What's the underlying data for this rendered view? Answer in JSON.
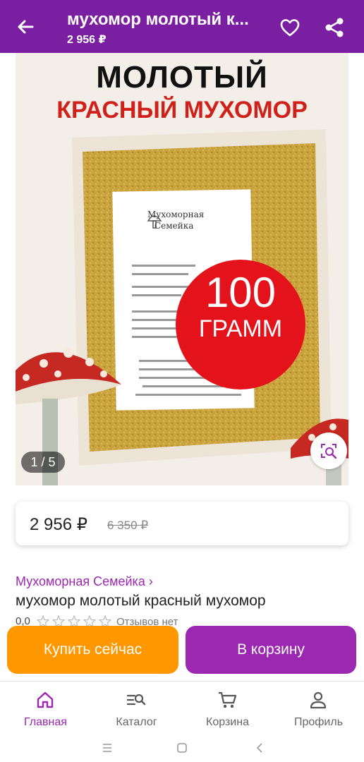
{
  "header": {
    "title": "мухомор молотый к...",
    "price": "2 956 ₽",
    "back_icon": "arrow-left-icon",
    "favorite_icon": "heart-icon",
    "share_icon": "share-icon",
    "bg_color": "#7b1fa2"
  },
  "gallery": {
    "image_text_line1": "МОЛОТЫЙ",
    "image_text_line2": "КРАСНЫЙ МУХОМОР",
    "badge_number": "100",
    "badge_unit": "ГРАММ",
    "label_brand_line1": "Мухоморная",
    "label_brand_line2": "Семейка",
    "counter": "1 / 5",
    "search_icon": "image-search-icon"
  },
  "price_card": {
    "price": "2 956 ₽",
    "old_price": "6 350 ₽"
  },
  "product": {
    "seller": "Мухоморная Семейка ›",
    "name": "мухомор молотый красный мухомор",
    "rating": "0,0",
    "stars": 0,
    "reviews": "Отзывов нет"
  },
  "actions": {
    "buy_now": "Купить сейчас",
    "add_to_cart": "В корзину",
    "buy_color": "#ff9800",
    "cart_color": "#9c27b0"
  },
  "bottom_nav": [
    {
      "label": "Главная",
      "icon": "home-icon",
      "active": true
    },
    {
      "label": "Каталог",
      "icon": "catalog-search-icon",
      "active": false
    },
    {
      "label": "Корзина",
      "icon": "cart-icon",
      "active": false
    },
    {
      "label": "Профиль",
      "icon": "profile-icon",
      "active": false
    }
  ]
}
